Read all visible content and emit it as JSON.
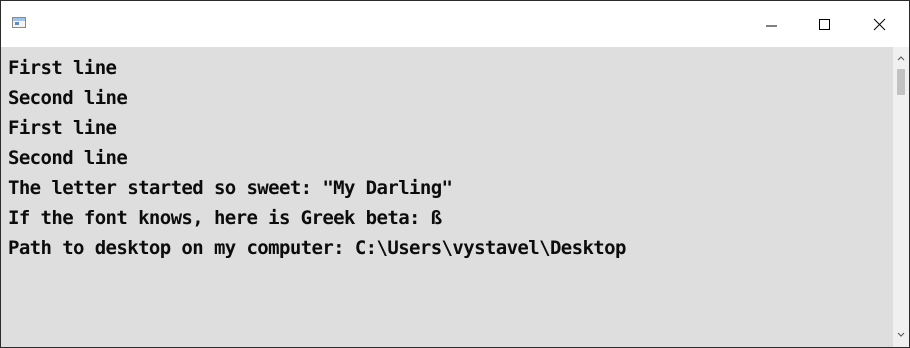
{
  "window": {
    "title": "",
    "icon": "console-app-icon",
    "buttons": {
      "minimize_icon": "minimize-icon",
      "maximize_icon": "maximize-icon",
      "close_icon": "close-icon"
    }
  },
  "console": {
    "background": "#dedede",
    "text_color": "#0c0c0c",
    "lines": [
      "First line",
      "Second line",
      "First line",
      "Second line",
      "The letter started so sweet: \"My Darling\"",
      "If the font knows, here is Greek beta: ß",
      "Path to desktop on my computer: C:\\Users\\vystavel\\Desktop"
    ]
  },
  "scrollbar": {
    "up_icon": "scroll-up-arrow-icon",
    "down_icon": "scroll-down-arrow-icon"
  }
}
